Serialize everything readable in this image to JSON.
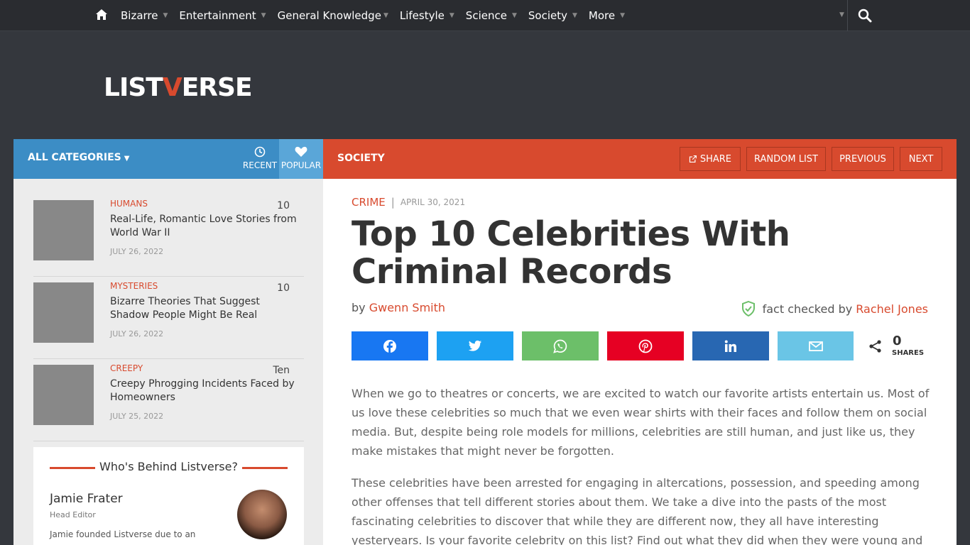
{
  "topnav": {
    "home_icon": "home-icon",
    "items": [
      {
        "label": "Bizarre"
      },
      {
        "label": "Entertainment"
      },
      {
        "label": "General Knowledge"
      },
      {
        "label": "Lifestyle"
      },
      {
        "label": "Science"
      },
      {
        "label": "Society"
      },
      {
        "label": "More"
      }
    ],
    "search_icon": "search-icon"
  },
  "logo": {
    "part1": "LIST",
    "v": "V",
    "part2": "ERSE"
  },
  "sidebar": {
    "all_categories": "ALL CATEGORIES",
    "tab_recent": "RECENT",
    "tab_popular": "POPULAR",
    "items": [
      {
        "category": "HUMANS",
        "count": "10",
        "title": "Real-Life, Romantic Love Stories from World War II",
        "date": "JULY 26, 2022"
      },
      {
        "category": "MYSTERIES",
        "count": "10",
        "title": "Bizarre Theories That Suggest Shadow People Might Be Real",
        "date": "JULY 26, 2022"
      },
      {
        "category": "CREEPY",
        "count": "Ten",
        "title": "Creepy Phrogging Incidents Faced by Homeowners",
        "date": "JULY 25, 2022"
      }
    ],
    "who": {
      "heading": "Who's Behind Listverse?",
      "name": "Jamie Frater",
      "role": "Head Editor",
      "desc": "Jamie founded Listverse due to an"
    }
  },
  "mainbar": {
    "section": "SOCIETY",
    "share": "SHARE",
    "random": "RANDOM LIST",
    "previous": "PREVIOUS",
    "next": "NEXT"
  },
  "article": {
    "category": "CRIME",
    "date": "APRIL 30, 2021",
    "title": "Top 10 Celebrities With Criminal Records",
    "by_prefix": "by",
    "author": "Gwenn Smith",
    "factcheck_prefix": "fact checked by",
    "factchecker": "Rachel Jones",
    "share_count": "0",
    "shares_label": "SHARES",
    "para1": "When we go to theatres or concerts, we are excited to watch our favorite artists entertain us. Most of us love these celebrities so much that we even wear shirts with their faces and follow them on social media.  But, despite being role models for millions, celebrities are still human, and just like us, they make mistakes that might never be forgotten.",
    "para2": "These celebrities have been arrested for engaging in altercations, possession, and speeding among other offenses that tell different stories about them. We take a dive into the pasts of the most fascinating celebrities to discover that while they are different now, they all have interesting yesteryears. Is your favorite celebrity on this list? Find out what they did when they were young and wild!"
  },
  "share_buttons": [
    {
      "network": "facebook",
      "icon": "facebook-icon",
      "color": "#1877f2"
    },
    {
      "network": "twitter",
      "icon": "twitter-icon",
      "color": "#1da1f2"
    },
    {
      "network": "whatsapp",
      "icon": "whatsapp-icon",
      "color": "#6cbf69"
    },
    {
      "network": "pinterest",
      "icon": "pinterest-icon",
      "color": "#e60023"
    },
    {
      "network": "linkedin",
      "icon": "linkedin-icon",
      "color": "#2867b2"
    },
    {
      "network": "email",
      "icon": "email-icon",
      "color": "#6ac5e6"
    }
  ],
  "colors": {
    "accent": "#d84a2e",
    "sidebar_blue": "#3c8dc5",
    "header_dark": "#34373d"
  }
}
